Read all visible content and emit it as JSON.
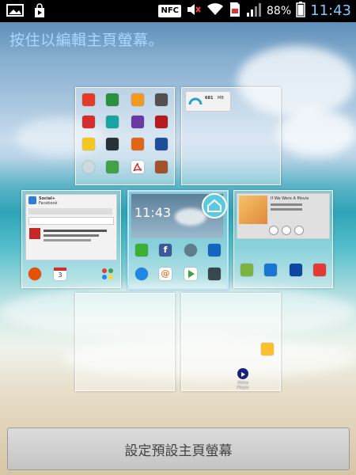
{
  "status_bar": {
    "left_icons": [
      "gallery-icon",
      "play-store-icon"
    ],
    "nfc_label": "NFC",
    "right_icons": [
      "mute-icon",
      "wifi-icon",
      "sim-icon",
      "signal-icon",
      "battery-icon"
    ],
    "battery_percent": "88%",
    "time": "11:43"
  },
  "hint_text": "按住以編輯主頁螢幕。",
  "pages": [
    {
      "name": "page-1",
      "icons": [
        "app-red",
        "app-green",
        "app-orange",
        "app-gray",
        "app-red2",
        "app-teal",
        "app-purple",
        "app-red3",
        "app-yellow",
        "app-dark",
        "app-orange2",
        "app-blue",
        "app-spiral",
        "app-green2",
        "app-acrobat",
        "app-brown"
      ]
    },
    {
      "name": "page-2",
      "widget_value": "681",
      "widget_unit": "MB"
    },
    {
      "name": "page-3",
      "widget_title": "Social+",
      "widget_subtitle": "Facebook",
      "icons": [
        "clock-icon",
        "calendar-icon",
        "apps-dots-icon"
      ],
      "calendar_day": "3"
    },
    {
      "name": "page-4",
      "clock": "11:43",
      "icons": [
        "line-icon",
        "facebook-icon",
        "settings-icon",
        "video-icon",
        "globe-icon",
        "at-icon",
        "play-icon",
        "camera-icon"
      ]
    },
    {
      "name": "page-5",
      "music_title": "If We Were A Movie",
      "icons": [
        "gallery-icon",
        "apps-icon",
        "clapper-icon",
        "youtube-icon"
      ]
    },
    {
      "name": "page-6"
    },
    {
      "name": "page-7",
      "icons": [
        "app-grid-icon",
        "video-player-icon"
      ],
      "icon_label": "Video Player"
    }
  ],
  "set_default_button": "設定預設主頁螢幕"
}
